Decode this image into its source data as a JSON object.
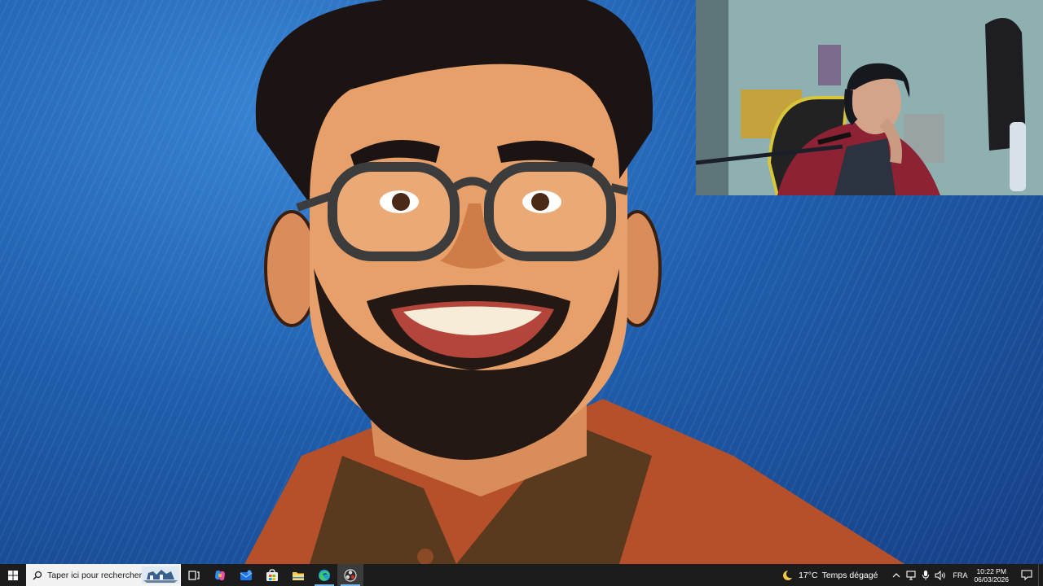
{
  "wallpaper": {
    "description_icon": "cartoon-portrait-wallpaper"
  },
  "webcam": {
    "icon": "webcam-feed"
  },
  "taskbar": {
    "start_icon": "windows-logo-icon",
    "search": {
      "placeholder": "Taper ici pour rechercher",
      "icon": "search-icon"
    },
    "apps": [
      {
        "name": "task-view",
        "icon": "task-view-icon"
      },
      {
        "name": "copilot",
        "icon": "copilot-icon"
      },
      {
        "name": "mail",
        "icon": "mail-icon"
      },
      {
        "name": "store",
        "icon": "store-icon"
      },
      {
        "name": "file-explorer",
        "icon": "folder-icon"
      },
      {
        "name": "edge",
        "icon": "edge-icon"
      },
      {
        "name": "obs",
        "icon": "obs-icon"
      }
    ],
    "weather": {
      "temperature": "17°C",
      "condition": "Temps dégagé",
      "icon": "moon-icon"
    },
    "language": "FRA",
    "time": "10:22 PM",
    "date": "06/03/2026"
  },
  "colors": {
    "taskbar_bg": "#1c1c1c",
    "accent": "#76b9ed",
    "wallpaper_blue": "#1f5fae"
  }
}
